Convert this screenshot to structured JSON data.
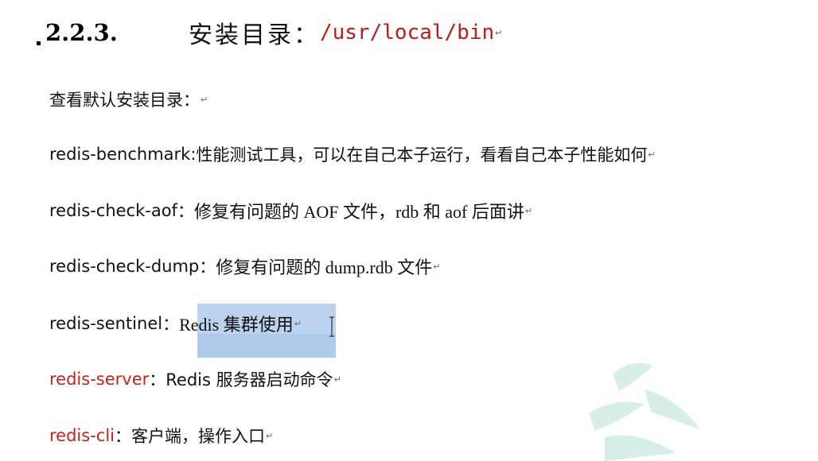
{
  "heading": {
    "number": "2.2.3.",
    "title": "安装目录：",
    "path": "/usr/local/bin"
  },
  "paragraph_mark": "↵",
  "lines": [
    {
      "cmd": "",
      "sep": "",
      "desc": "查看默认安装目录：",
      "red": false
    },
    {
      "cmd": "redis-benchmark",
      "sep": ":",
      "desc": "性能测试工具，可以在自己本子运行，看看自己本子性能如何",
      "red": false
    },
    {
      "cmd": "redis-check-aof",
      "sep": "：",
      "desc": "修复有问题的 AOF 文件，rdb 和 aof 后面讲",
      "red": false
    },
    {
      "cmd": "redis-check-dump",
      "sep": "：",
      "desc": "修复有问题的 dump.rdb 文件",
      "red": false
    },
    {
      "cmd": "redis-sentinel",
      "sep": "：",
      "desc": "Redis 集群使用",
      "red": false
    },
    {
      "cmd": "redis-server",
      "sep": "：",
      "desc": "Redis 服务器启动命令",
      "red": true
    },
    {
      "cmd": "redis-cli",
      "sep": "：",
      "desc": "客户端，操作入口",
      "red": true
    }
  ],
  "colors": {
    "command_red": "#c0241e",
    "path_red": "#b81d1d",
    "selection": "#a9c6ea",
    "watermark": "#d8efe8"
  }
}
